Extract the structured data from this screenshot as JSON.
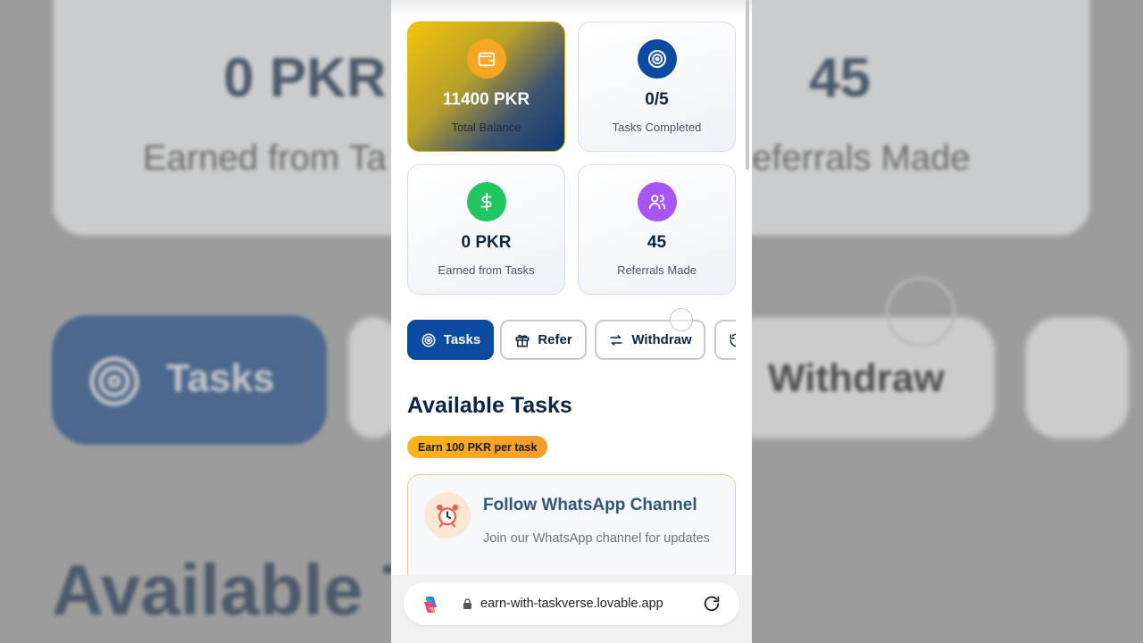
{
  "background": {
    "stat_earned_value": "0 PKR",
    "stat_earned_label": "Earned from Ta",
    "stat_referrals_value": "45",
    "stat_referrals_label": "eferrals Made",
    "tab_tasks": "Tasks",
    "tab_withdraw": "Withdraw",
    "section_title": "Available T"
  },
  "stats": [
    {
      "value": "11400 PKR",
      "label": "Total Balance",
      "icon": "wallet-icon",
      "color": "#f5a623"
    },
    {
      "value": "0/5",
      "label": "Tasks Completed",
      "icon": "target-icon",
      "color": "#0b4a9e"
    },
    {
      "value": "0 PKR",
      "label": "Earned from Tasks",
      "icon": "dollar-icon",
      "color": "#22c55e"
    },
    {
      "value": "45",
      "label": "Referrals Made",
      "icon": "users-icon",
      "color": "#a855f7"
    }
  ],
  "tabs": [
    {
      "label": "Tasks",
      "icon": "target-icon",
      "active": true
    },
    {
      "label": "Refer",
      "icon": "gift-icon",
      "active": false
    },
    {
      "label": "Withdraw",
      "icon": "swap-arrows-icon",
      "active": false
    },
    {
      "label": "",
      "icon": "history-icon",
      "active": false
    }
  ],
  "tasks_section": {
    "title": "Available Tasks",
    "badge": "Earn 100 PKR per task"
  },
  "task": {
    "icon": "alarm-clock-icon",
    "title": "Follow WhatsApp Channel",
    "description": "Join our WhatsApp channel for updates"
  },
  "browser": {
    "url": "earn-with-taskverse.lovable.app"
  }
}
